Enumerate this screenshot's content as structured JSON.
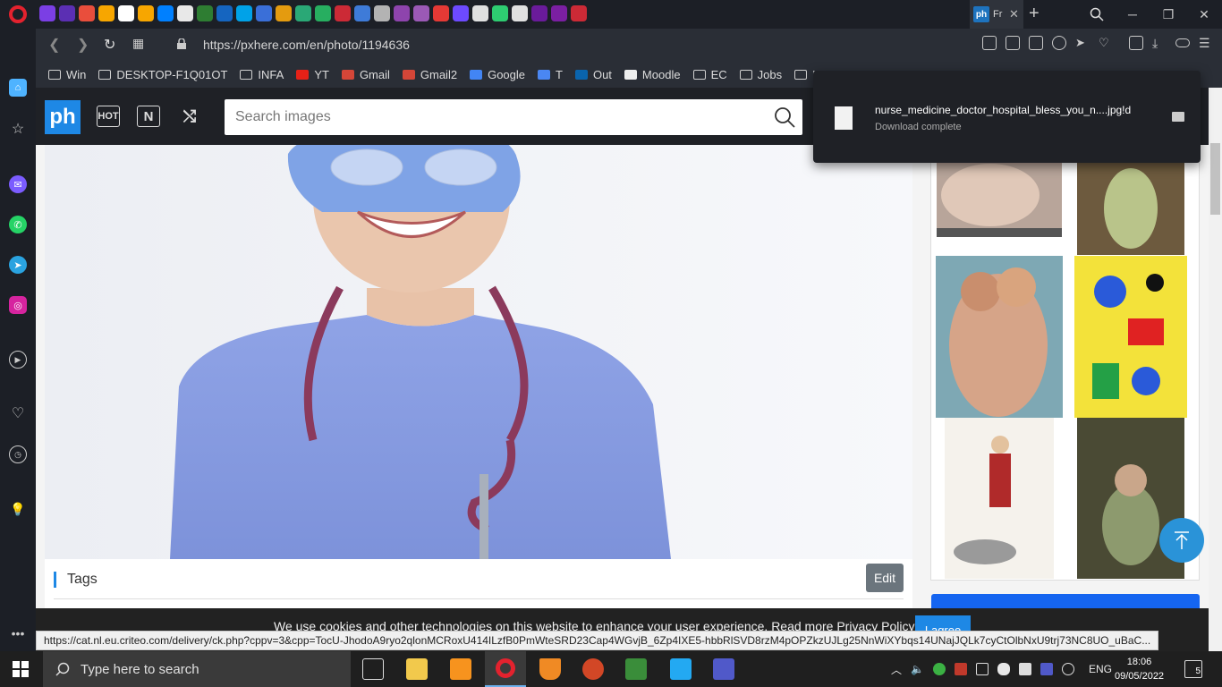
{
  "browser": {
    "active_tab_favicon": "ph",
    "active_tab_title": "Fr",
    "url": "https://pxhere.com/en/photo/1194636",
    "tab_favicon_colors": [
      "#7b3fe4",
      "#5b2fb3",
      "#e94e3c",
      "#f7a600",
      "#ffffff",
      "#f7a600",
      "#0080ff",
      "#e8e8e8",
      "#2e7d32",
      "#1565c0",
      "#00a2e8",
      "#3a6fd8",
      "#e49b0f",
      "#2aa876",
      "#27ae60",
      "#cc2a36",
      "#3e7bd8",
      "#b3b3b3",
      "#8e44ad",
      "#9b59b6",
      "#e53935",
      "#6d4aff",
      "#e0e0e0",
      "#2ecc71",
      "#e0e0e0",
      "#6a1b9a",
      "#7b1fa2",
      "#cc2a36"
    ]
  },
  "bookmarks": [
    {
      "label": "Win",
      "icon": "folder-icon"
    },
    {
      "label": "DESKTOP-F1Q01OT",
      "icon": "folder-icon"
    },
    {
      "label": "INFA",
      "icon": "folder-icon"
    },
    {
      "label": "YT",
      "icon": "youtube-icon"
    },
    {
      "label": "Gmail",
      "icon": "gmail-icon"
    },
    {
      "label": "Gmail2",
      "icon": "gmail-icon"
    },
    {
      "label": "Google",
      "icon": "google-icon"
    },
    {
      "label": "T",
      "icon": "translate-icon"
    },
    {
      "label": "Out",
      "icon": "outlook-icon"
    },
    {
      "label": "Moodle",
      "icon": "moodle-icon"
    },
    {
      "label": "EC",
      "icon": "folder-icon"
    },
    {
      "label": "Jobs",
      "icon": "folder-icon"
    },
    {
      "label": "Hou",
      "icon": "folder-icon"
    }
  ],
  "site": {
    "logo": "ph",
    "hot_label": "HOT",
    "new_label": "N",
    "search_placeholder": "Search images",
    "tags_title": "Tags",
    "edit_label": "Edit",
    "cookie_text": "We use cookies and other technologies on this website to enhance your user experience. Read more Privacy Policy",
    "cookie_button": "I agree"
  },
  "download": {
    "file_name": "nurse_medicine_doctor_hospital_bless_you_n....jpg!d",
    "status": "Download complete"
  },
  "status_bar": {
    "link": "https://cat.nl.eu.criteo.com/delivery/ck.php?cppv=3&cpp=TocU-JhodoA9ryo2qlonMCRoxU414ILzfB0PmWteSRD23Cap4WGvjB_6Zp4IXE5-hbbRlSVD8rzM4pOPZkzUJLg25NnWiXYbqs14UNajJQLk7cyCtOlbNxU9trj73NC8UO_uBaC..."
  },
  "taskbar": {
    "search_placeholder": "Type here to search",
    "language": "ENG",
    "time": "18:06",
    "date": "09/05/2022",
    "notifications": "5"
  }
}
